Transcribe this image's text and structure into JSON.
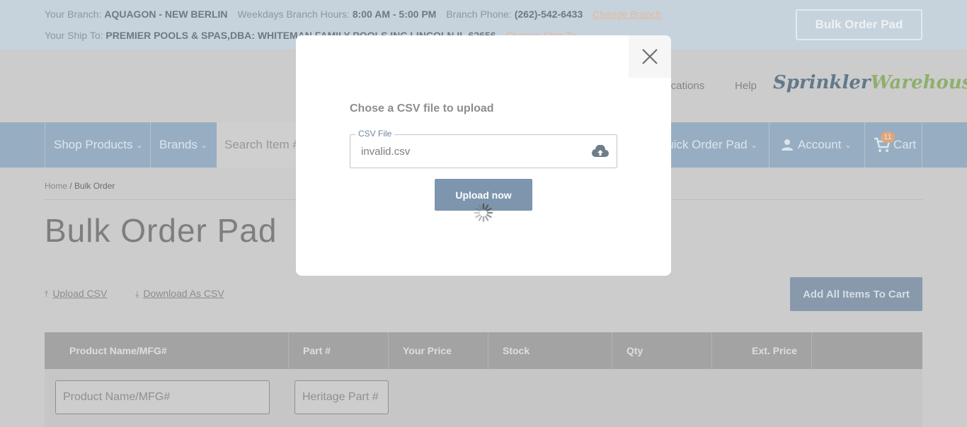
{
  "topbar": {
    "branch_label": "Your Branch:",
    "branch_name": "AQUAGON - NEW BERLIN",
    "hours_label": "Weekdays Branch Hours:",
    "hours_value": "8:00 AM - 5:00 PM",
    "phone_label": "Branch Phone:",
    "phone_value": "(262)-542-6433",
    "change_branch": "Change Branch",
    "shipto_label": "Your Ship To:",
    "shipto_value": "PREMIER POOLS & SPAS,DBA: WHITEMAN FAMILY POOLS INC LINCOLN IL 62656",
    "change_shipto": "Change Ship To",
    "bulk_order_pad": "Bulk Order Pad"
  },
  "header": {
    "locations": "Locations",
    "help": "Help",
    "logo_part1": "Sprinkler",
    "logo_part2": "Warehouse"
  },
  "nav": {
    "shop_products": "Shop Products",
    "brands": "Brands",
    "search_placeholder": "Search Item #",
    "quick_order_pad": "Quick Order Pad",
    "account": "Account",
    "cart": "Cart",
    "cart_count": "11"
  },
  "main": {
    "breadcrumb_home": "Home",
    "breadcrumb_sep": " / ",
    "breadcrumb_current": "Bulk Order",
    "title": "Bulk Order Pad",
    "upload_csv": "Upload CSV",
    "download_csv": "Download As CSV",
    "add_all": "Add All Items To Cart",
    "columns": [
      "Product Name/MFG#",
      "Part #",
      "Your Price",
      "Stock",
      "Qty",
      "Ext. Price"
    ],
    "product_placeholder": "Product Name/MFG#",
    "part_placeholder": "Heritage Part #"
  },
  "modal": {
    "title": "Chose a CSV file to upload",
    "field_label": "CSV File",
    "file_value": "invalid.csv",
    "upload_button": "Upload now"
  },
  "colors": {
    "accent": "#7d95ad",
    "cart_badge": "#dca67e"
  }
}
